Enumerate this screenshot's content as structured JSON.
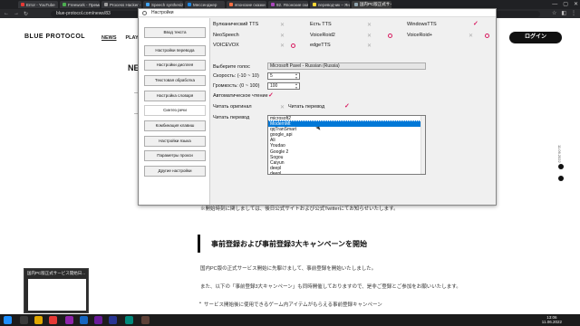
{
  "browser": {
    "tabs": [
      {
        "label": "Error - YouTube",
        "fav": "#e53935"
      },
      {
        "label": "Freework - Премиаль",
        "fav": "#4caf50"
      },
      {
        "label": "Process Hacker - Прод",
        "fav": "#9e9e9e"
      },
      {
        "label": "Speech synthesizer for",
        "fav": "#42a5f5"
      },
      {
        "label": "Мессенджер",
        "fav": "#1e88e5"
      },
      {
        "label": "японские сказки на",
        "fav": "#ff7043"
      },
      {
        "label": "92. Японские сказки",
        "fav": "#ab47bc"
      },
      {
        "label": "переводчик – Яндекс",
        "fav": "#fdd835"
      },
      {
        "label": "国内PC版正式サービ",
        "fav": "#90a4ae"
      }
    ],
    "url": "blue-protocol.com/news/83",
    "win_min": "—",
    "win_max": "▢",
    "win_close": "✕"
  },
  "site": {
    "logo": "BLUE PROTOCOL",
    "nav": [
      "NEWS",
      "PLAY"
    ],
    "login": "ログイン",
    "heading": "NE",
    "frag1": "—",
    "frag2": "—",
    "notice": "※開始時刻に関しましては、後日公式サイトおよび公式Twitterにてお知らせいたします。",
    "section_title": "事前登録および事前登録3大キャンペーンを開始",
    "p1": "国内PC版の正式サービス開始に先駆けまして、事前登録を開始いたしました。",
    "p2": "また、以下の「事前登録3大キャンペーン」も同時開催しておりますので、是非ご登録とご参加をお願いいたします。",
    "bullet": "サービス開始後に使用できるゲーム内アイテムがもらえる事前登録キャンペーン",
    "side_date": "11.06.2022"
  },
  "dialog": {
    "title": "Настройки",
    "sidebar": [
      "Ввод текста",
      "Настройки перевода",
      "Настройки дисплея",
      "Текстовая обработка",
      "Настройка словаря",
      "Синтез речи",
      "Комбинация клавиш",
      "Настройки языка",
      "Параметры прокси",
      "Другие настройки"
    ],
    "selected_sidebar": "Синтез речи",
    "engines": [
      {
        "name": "Вулканический TTS",
        "state": "x"
      },
      {
        "name": "Есть TTS",
        "state": "x"
      },
      {
        "name": "WindowsTTS",
        "state": "check"
      },
      {
        "name": "NeoSpeech",
        "state": "x"
      },
      {
        "name": "VoiceRoid2",
        "state": "gear"
      },
      {
        "name": "VoiceRoid+",
        "state": "gear"
      },
      {
        "name": "VOICEVOX",
        "state": "gear"
      },
      {
        "name": "edgeTTS",
        "state": "x"
      }
    ],
    "voice_label": "Выберите голос",
    "voice_value": "Microsoft Pavel - Russian (Russia)",
    "speed_label": "Скорость: (-10 ~ 10)",
    "speed_value": "5",
    "volume_label": "Громкость: (0 ~ 100)",
    "volume_value": "100",
    "autoread_label": "Автоматическое чтение",
    "read_original_label": "Читать оригинал",
    "read_translation_label": "Читать перевод",
    "read_translation_label_lower": "Читать перевод",
    "translate_options": [
      "microsoft2",
      "ModernMt",
      "qqTranSmart",
      "google_api",
      "Ali",
      "Youdao",
      "Google 2",
      "Sogou",
      "Caiyun",
      "deepl",
      "deepl"
    ],
    "translate_selected": "microsoft2",
    "translate_highlighted": "ModernMt"
  },
  "taskbar": {
    "thumb_caption": "国内PC版正式サービス開始日...",
    "time": "13:06",
    "date": "11.06.2022"
  }
}
